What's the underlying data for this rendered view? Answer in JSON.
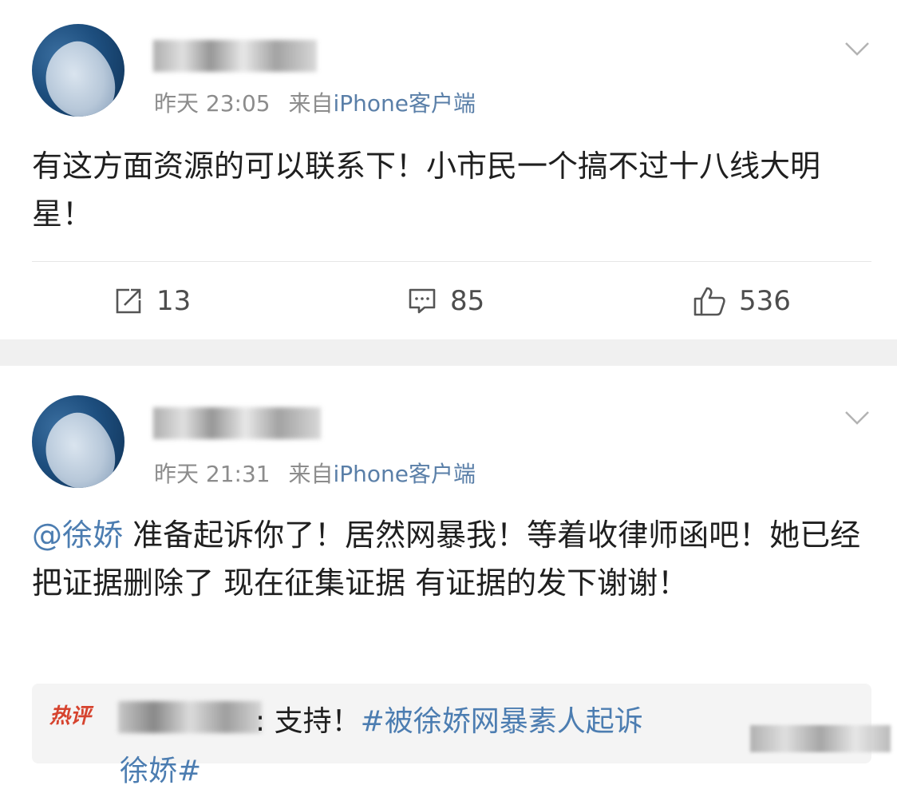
{
  "post1": {
    "avatar": "whale-avatar",
    "timestamp": "昨天 23:05",
    "source_prefix": "来自",
    "source": "iPhone客户端",
    "text": "有这方面资源的可以联系下！小市民一个搞不过十八线大明星！",
    "actions": {
      "repost_count": "13",
      "comment_count": "85",
      "like_count": "536"
    }
  },
  "post2": {
    "avatar": "whale-avatar",
    "timestamp": "昨天 21:31",
    "source_prefix": "来自",
    "source": "iPhone客户端",
    "mention": "@徐娇",
    "text": " 准备起诉你了！居然网暴我！等着收律师函吧！她已经把证据删除了 现在征集证据 有证据的发下谢谢！",
    "hot_comment": {
      "badge": "热评",
      "text_prefix": ": 支持！",
      "hashtag": "#被徐娇网暴素人起诉",
      "hashtag_cont": "徐娇#"
    }
  },
  "icons": {
    "menu": "chevron-down-icon",
    "repost": "repost-icon",
    "comment": "comment-icon",
    "like": "thumbs-up-icon"
  },
  "colors": {
    "link": "#4c7db1",
    "meta": "#8c8c8c",
    "hot_badge": "#d6432e",
    "separator": "#f0f0f0"
  }
}
